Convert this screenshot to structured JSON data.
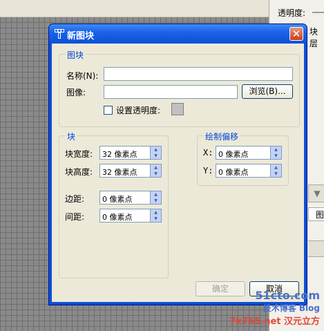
{
  "background": {
    "transparency_label": "透明度:",
    "layer_label": "块层",
    "side_label": "图"
  },
  "dialog": {
    "title": "新图块",
    "close_glyph": "✕",
    "block_group": {
      "legend": "图块",
      "name_label": "名称(N):",
      "name_value": "",
      "image_label": "图像:",
      "image_value": "",
      "browse_label": "浏览(B)...",
      "transparency_label": "设置透明度:",
      "transparency_checked": false,
      "transparency_color": "#c0c0c0"
    },
    "size_group": {
      "legend": "块",
      "width_label": "块宽度:",
      "width_value": "32 像素点",
      "height_label": "块高度:",
      "height_value": "32 像素点",
      "margin_label": "边距:",
      "margin_value": "0 像素点",
      "spacing_label": "间距:",
      "spacing_value": "0 像素点"
    },
    "offset_group": {
      "legend": "绘制偏移",
      "x_label": "X:",
      "x_value": "0 像素点",
      "y_label": "Y:",
      "y_value": "0 像素点"
    },
    "ok_label": "确定",
    "cancel_label": "取消"
  },
  "watermark": {
    "line1": "51cto.com",
    "line2": "技术博客 Blog",
    "line3": "7k765.net 汉元立方"
  }
}
